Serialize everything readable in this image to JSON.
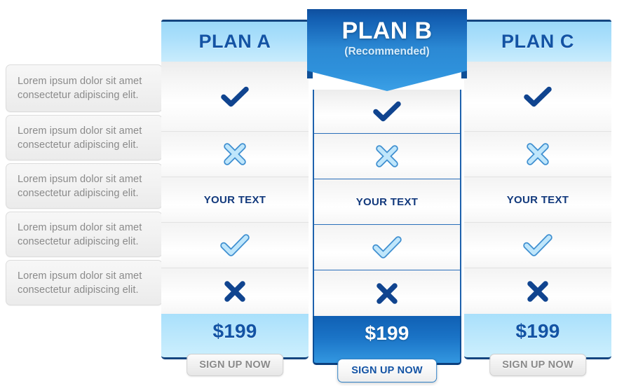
{
  "features": {
    "rows": [
      {
        "text": "Lorem ipsum dolor sit amet\nconsectetur adipiscing elit."
      },
      {
        "text": "Lorem ipsum dolor sit amet\nconsectetur adipiscing elit."
      },
      {
        "text": "Lorem ipsum dolor sit amet\nconsectetur adipiscing elit."
      },
      {
        "text": "Lorem ipsum dolor sit amet\nconsectetur adipiscing elit."
      },
      {
        "text": "Lorem ipsum dolor sit amet\nconsectetur adipiscing elit."
      }
    ]
  },
  "plans": {
    "a": {
      "title": "PLAN A",
      "price": "$199",
      "cta": "SIGN UP NOW",
      "cells": [
        {
          "type": "check-dark",
          "icon": "check-icon"
        },
        {
          "type": "cross-light",
          "icon": "cross-icon"
        },
        {
          "type": "text",
          "icon": "",
          "label": "YOUR TEXT"
        },
        {
          "type": "check-light",
          "icon": "check-icon"
        },
        {
          "type": "cross-dark",
          "icon": "cross-icon"
        }
      ]
    },
    "b": {
      "title": "PLAN B",
      "subtitle": "(Recommended)",
      "price": "$199",
      "cta": "SIGN UP NOW",
      "cells": [
        {
          "type": "check-dark",
          "icon": "check-icon"
        },
        {
          "type": "cross-light",
          "icon": "cross-icon"
        },
        {
          "type": "text",
          "icon": "",
          "label": "YOUR TEXT"
        },
        {
          "type": "check-light",
          "icon": "check-icon"
        },
        {
          "type": "cross-dark",
          "icon": "cross-icon"
        }
      ]
    },
    "c": {
      "title": "PLAN C",
      "price": "$199",
      "cta": "SIGN UP NOW",
      "cells": [
        {
          "type": "check-dark",
          "icon": "check-icon"
        },
        {
          "type": "cross-light",
          "icon": "cross-icon"
        },
        {
          "type": "text",
          "icon": "",
          "label": "YOUR TEXT"
        },
        {
          "type": "check-light",
          "icon": "check-icon"
        },
        {
          "type": "cross-dark",
          "icon": "cross-icon"
        }
      ]
    }
  },
  "colors": {
    "dark_blue": "#14457f",
    "accent_blue": "#1353a4",
    "light_blue": "#aadffb",
    "ribbon_blue": "#1565c0",
    "icon_light": "#bfe6fb",
    "icon_dark": "#12549f",
    "feature_text": "#8a8a8a"
  }
}
